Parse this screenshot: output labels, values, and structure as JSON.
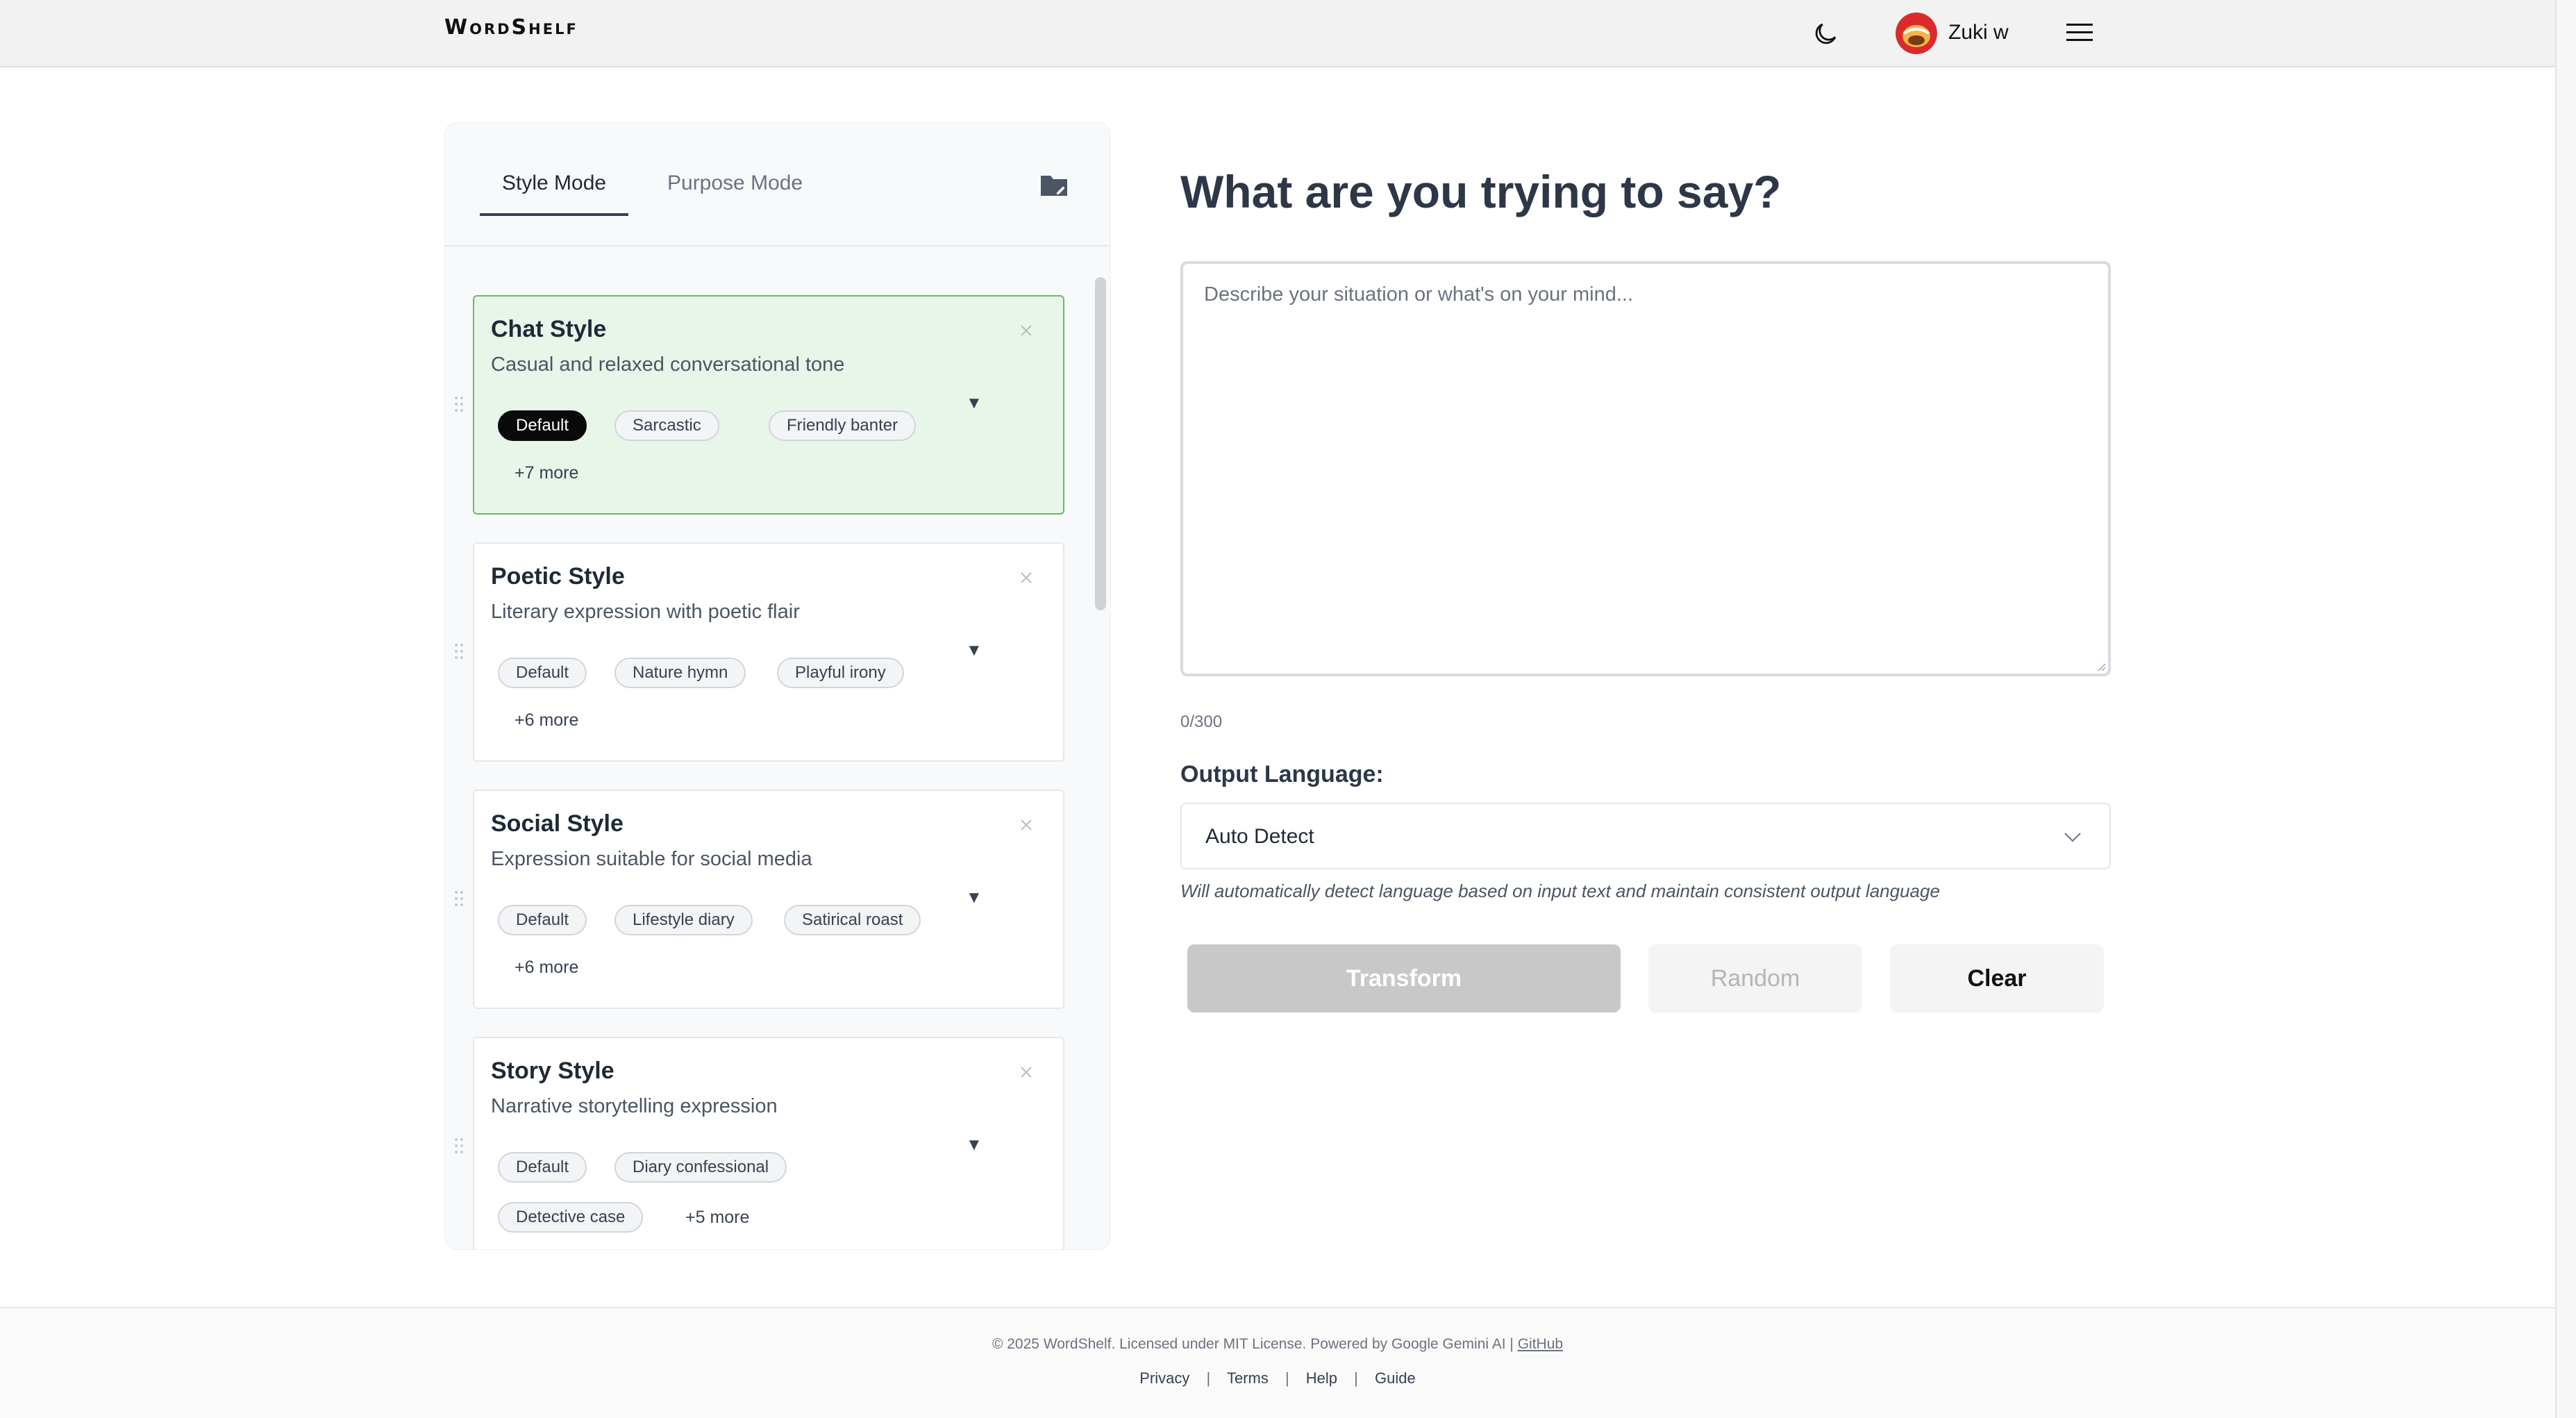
{
  "header": {
    "logo": "WordShelf",
    "theme_icon": "moon-icon",
    "user_name": "Zuki w",
    "menu_icon": "hamburger-icon"
  },
  "panel": {
    "tabs": [
      {
        "label": "Style Mode",
        "active": true
      },
      {
        "label": "Purpose Mode",
        "active": false
      }
    ],
    "folder_icon": "folder-edit-icon",
    "cards": [
      {
        "title": "Chat Style",
        "description": "Casual and relaxed conversational tone",
        "selected": true,
        "chips": [
          "Default",
          "Sarcastic",
          "Friendly banter"
        ],
        "active_chip": "Default",
        "more": "+7 more"
      },
      {
        "title": "Poetic Style",
        "description": "Literary expression with poetic flair",
        "selected": false,
        "chips": [
          "Default",
          "Nature hymn",
          "Playful irony"
        ],
        "more": "+6 more"
      },
      {
        "title": "Social Style",
        "description": "Expression suitable for social media",
        "selected": false,
        "chips": [
          "Default",
          "Lifestyle diary",
          "Satirical roast"
        ],
        "more": "+6 more"
      },
      {
        "title": "Story Style",
        "description": "Narrative storytelling expression",
        "selected": false,
        "chips": [
          "Default",
          "Diary confessional",
          "Detective case"
        ],
        "more": "+5 more"
      }
    ]
  },
  "main": {
    "heading": "What are you trying to say?",
    "textarea_placeholder": "Describe your situation or what's on your mind...",
    "textarea_value": "",
    "counter": "0/300",
    "language_label": "Output Language:",
    "language_value": "Auto Detect",
    "language_hint": "Will automatically detect language based on input text and maintain consistent output language",
    "buttons": {
      "transform": "Transform",
      "random": "Random",
      "clear": "Clear"
    }
  },
  "footer": {
    "copyright": "© 2025 WordShelf. Licensed under MIT License. Powered by Google Gemini AI |",
    "github": "GitHub",
    "links": [
      "Privacy",
      "Terms",
      "Help",
      "Guide"
    ],
    "separator": "|"
  },
  "colors": {
    "selected_card_bg": "#e8f5e9",
    "selected_card_border": "#66bb6a",
    "active_chip": "#0a0a0a",
    "disabled_button": "#c8c8c8"
  }
}
